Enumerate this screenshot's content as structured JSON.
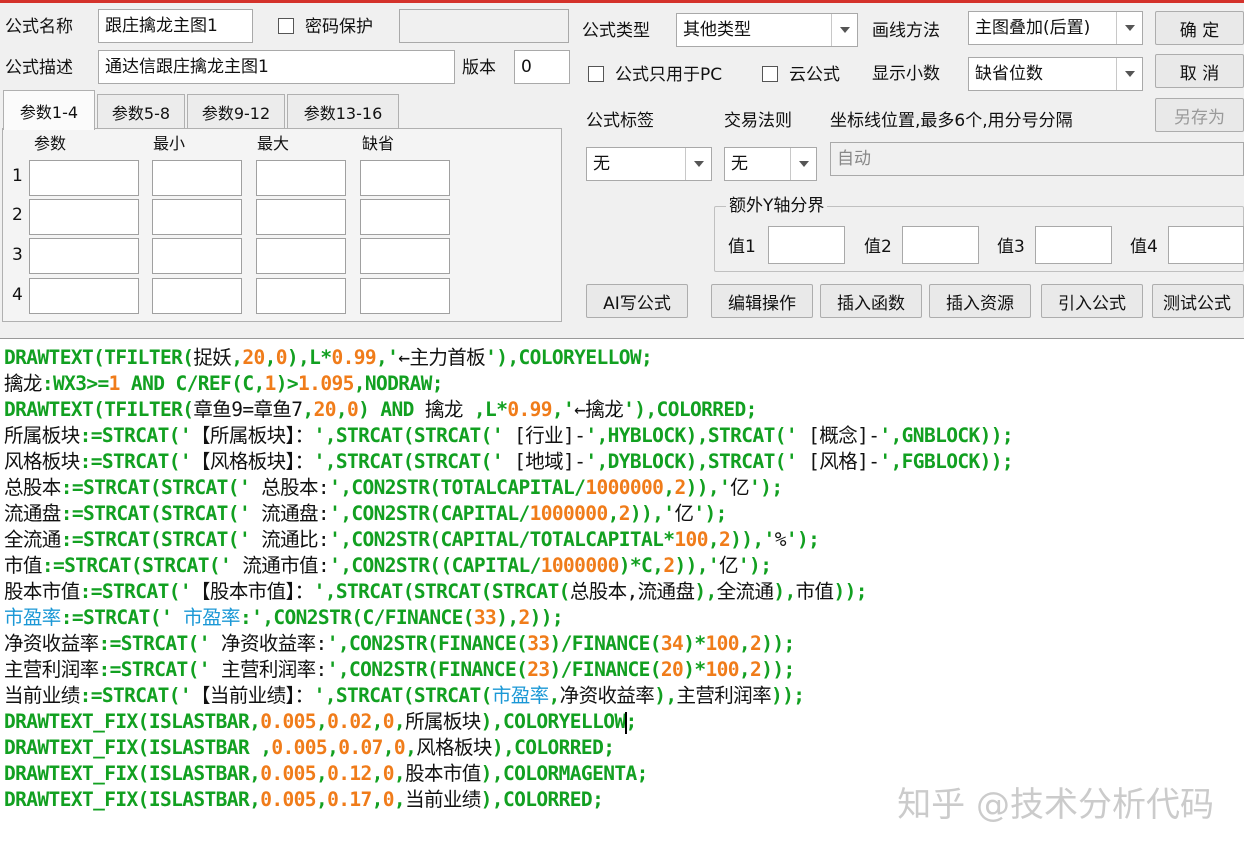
{
  "header": {
    "name_label": "公式名称",
    "name_value": "跟庄擒龙主图1",
    "password_label": "密码保护",
    "desc_label": "公式描述",
    "desc_value": "通达信跟庄擒龙主图1",
    "version_label": "版本",
    "version_value": "0",
    "type_label": "公式类型",
    "type_value": "其他类型",
    "draw_label": "画线方法",
    "draw_value": "主图叠加(后置)",
    "pc_only_label": "公式只用于PC",
    "cloud_label": "云公式",
    "decimals_label": "显示小数",
    "decimals_value": "缺省位数",
    "tag_label": "公式标签",
    "tag_value": "无",
    "trade_label": "交易法则",
    "trade_value": "无",
    "axis_label": "坐标线位置,最多6个,用分号分隔",
    "axis_value": "自动",
    "extra_y_label": "额外Y轴分界",
    "val1": "值1",
    "val2": "值2",
    "val3": "值3",
    "val4": "值4"
  },
  "buttons": {
    "ok": "确 定",
    "cancel": "取 消",
    "save_as": "另存为",
    "ai": "AI写公式",
    "edit": "编辑操作",
    "insert_func": "插入函数",
    "insert_res": "插入资源",
    "import": "引入公式",
    "test": "测试公式"
  },
  "tabs": [
    "参数1-4",
    "参数5-8",
    "参数9-12",
    "参数13-16"
  ],
  "params": {
    "col_param": "参数",
    "col_min": "最小",
    "col_max": "最大",
    "col_default": "缺省",
    "rows": [
      "1",
      "2",
      "3",
      "4"
    ]
  },
  "watermark": "知乎 @技术分析代码"
}
